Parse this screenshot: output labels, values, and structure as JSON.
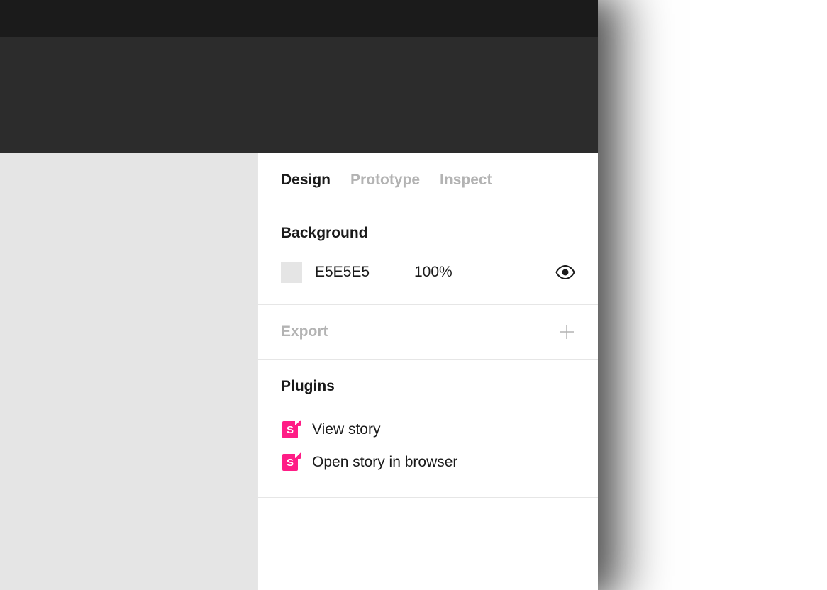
{
  "tabs": {
    "design": "Design",
    "prototype": "Prototype",
    "inspect": "Inspect",
    "active": "design"
  },
  "background": {
    "title": "Background",
    "hex": "E5E5E5",
    "opacity": "100%",
    "swatch_color": "#e5e5e5"
  },
  "export": {
    "label": "Export"
  },
  "plugins": {
    "title": "Plugins",
    "items": [
      {
        "label": "View story",
        "icon": "storybook"
      },
      {
        "label": "Open story in browser",
        "icon": "storybook"
      }
    ]
  }
}
